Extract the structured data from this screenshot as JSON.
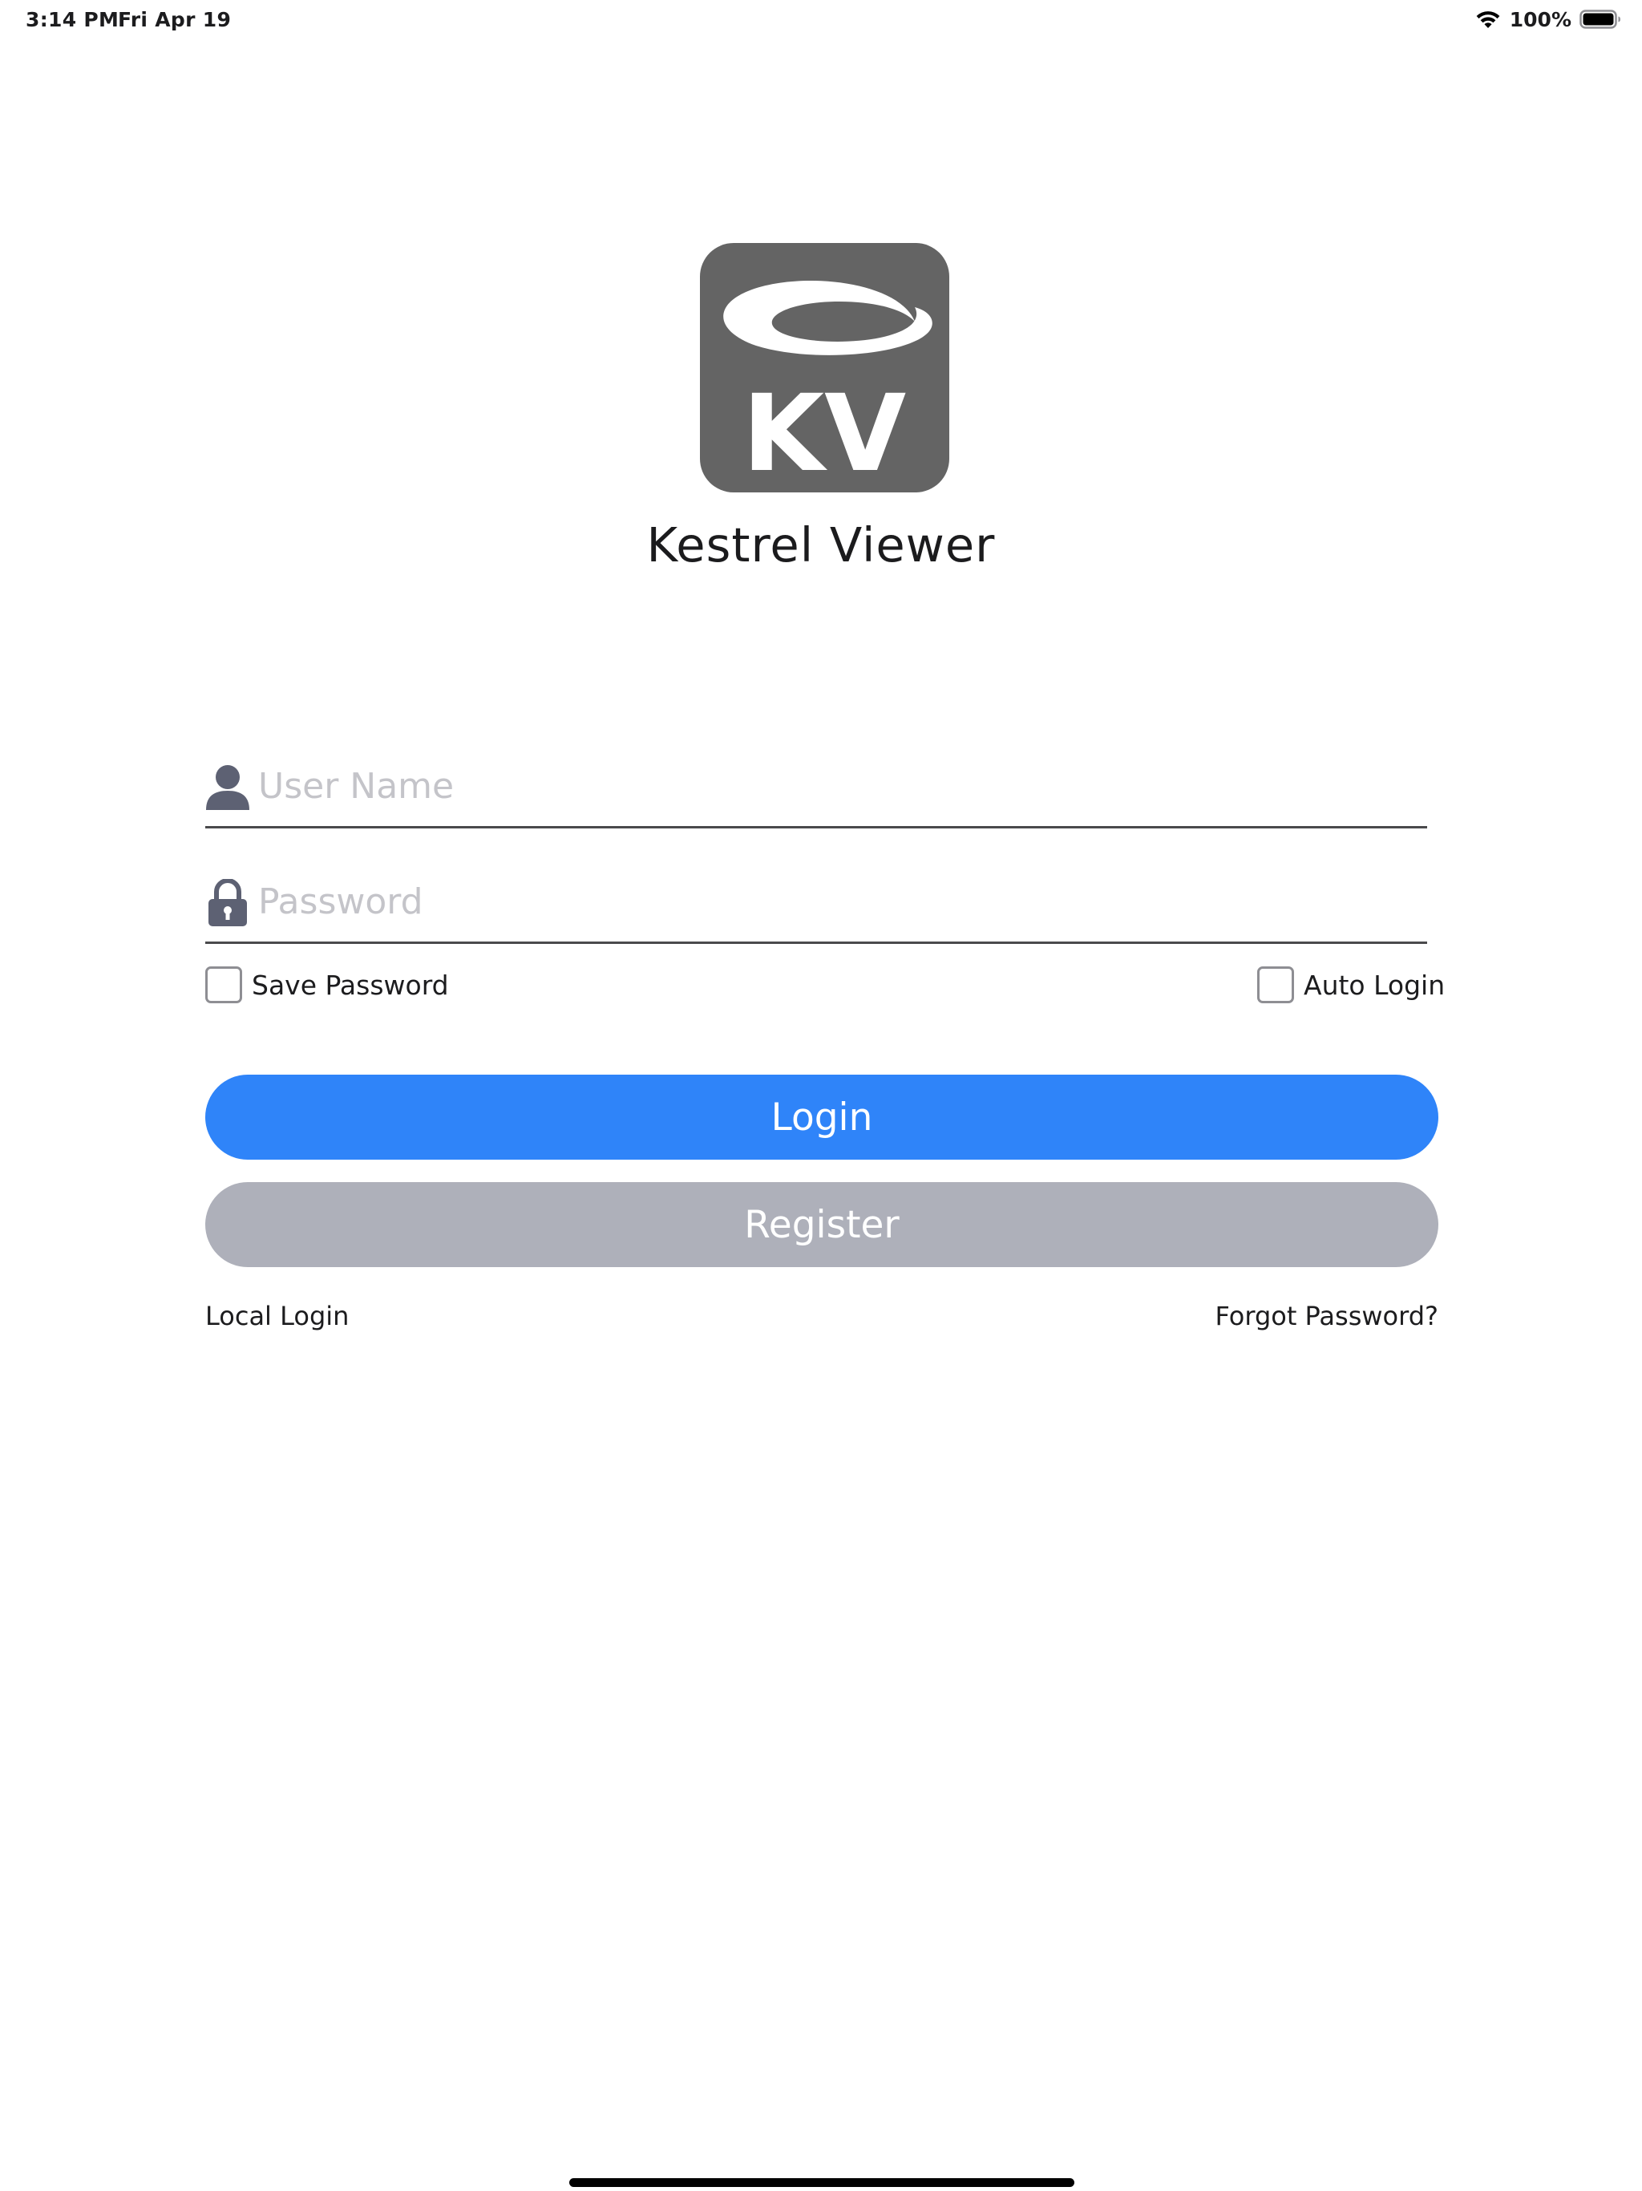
{
  "status_bar": {
    "time": "3:14 PM",
    "date": "Fri Apr 19",
    "battery_percent": "100%",
    "battery_level": 1.0,
    "wifi_icon": "wifi-icon",
    "battery_icon": "battery-icon"
  },
  "app": {
    "logo_text": "KV",
    "title": "Kestrel Viewer",
    "logo_color": "#646464"
  },
  "form": {
    "username": {
      "placeholder": "User Name",
      "value": "",
      "icon": "user-icon"
    },
    "password": {
      "placeholder": "Password",
      "value": "",
      "icon": "lock-icon"
    },
    "save_password": {
      "label": "Save Password",
      "checked": false
    },
    "auto_login": {
      "label": "Auto Login",
      "checked": false
    }
  },
  "buttons": {
    "login_label": "Login",
    "register_label": "Register",
    "login_color": "#2f84f9",
    "register_color": "#aeb0ba"
  },
  "links": {
    "local_login": "Local Login",
    "forgot_password": "Forgot Password?"
  }
}
